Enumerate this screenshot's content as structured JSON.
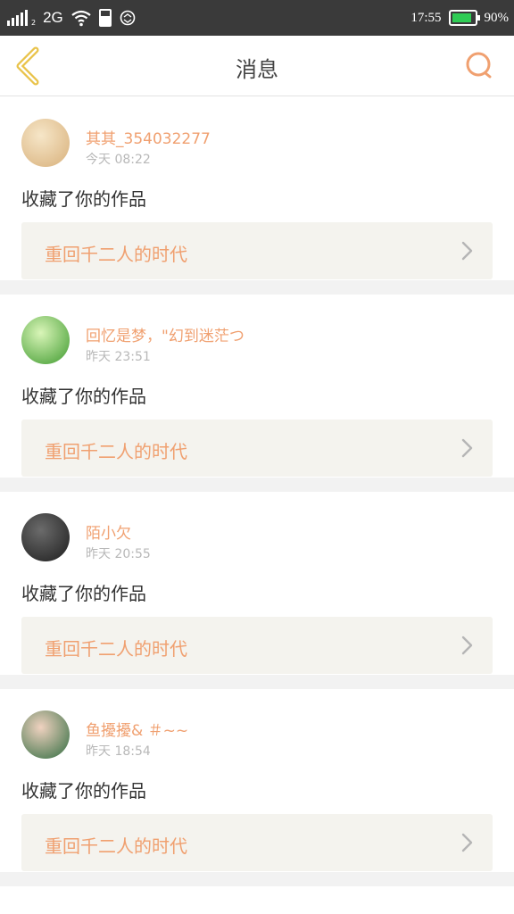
{
  "status_bar": {
    "signal_sub": "2",
    "network": "2G",
    "time": "17:55",
    "battery_percent": "90%",
    "battery_level": 0.9,
    "battery_color": "#2ecc54"
  },
  "header": {
    "title": "消息",
    "back_icon": "chevron-left-icon",
    "search_icon": "search-icon",
    "accent_color": "#f0a070"
  },
  "messages": [
    {
      "user": "其其_354032277",
      "time": "今天 08:22",
      "action": "收藏了你的作品",
      "work_title": "重回千二人的时代",
      "avatar_colors": [
        "#f6e6c8",
        "#d8b07a"
      ]
    },
    {
      "user": "回忆是梦，\"幻到迷茫つ",
      "time": "昨天 23:51",
      "action": "收藏了你的作品",
      "work_title": "重回千二人的时代",
      "avatar_colors": [
        "#d9f5b8",
        "#3e9a2e"
      ]
    },
    {
      "user": "陌小欠",
      "time": "昨天 20:55",
      "action": "收藏了你的作品",
      "work_title": "重回千二人的时代",
      "avatar_colors": [
        "#6b6b6b",
        "#1d1d1d"
      ]
    },
    {
      "user": "鱼擾擾& ＃~~",
      "time": "昨天 18:54",
      "action": "收藏了你的作品",
      "work_title": "重回千二人的时代",
      "avatar_colors": [
        "#f0d2c0",
        "#2f6b3f"
      ]
    }
  ]
}
